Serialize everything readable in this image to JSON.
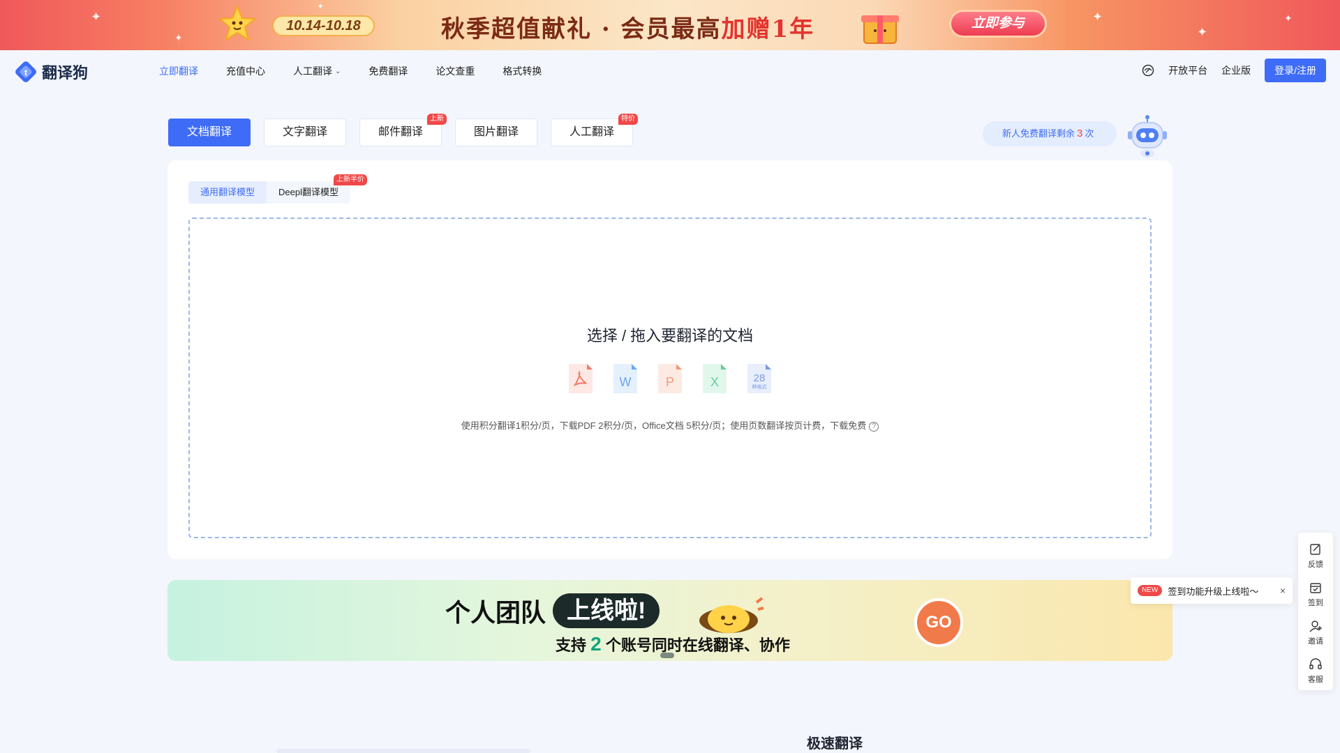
{
  "promo": {
    "date_range": "10.14-10.18",
    "headline_main": "秋季超值献礼 · 会员最高",
    "headline_highlight": "加赠1年",
    "cta_label": "立即参与"
  },
  "header": {
    "logo_text": "翻译狗",
    "nav": [
      {
        "label": "立即翻译",
        "active": true
      },
      {
        "label": "充值中心"
      },
      {
        "label": "人工翻译",
        "has_dropdown": true
      },
      {
        "label": "免费翻译"
      },
      {
        "label": "论文查重"
      },
      {
        "label": "格式转换"
      }
    ],
    "right": {
      "icon": "theme-icon",
      "open_platform": "开放平台",
      "enterprise": "企业版",
      "login_label": "登录/注册"
    }
  },
  "tabs": [
    {
      "label": "文档翻译",
      "active": true
    },
    {
      "label": "文字翻译"
    },
    {
      "label": "邮件翻译",
      "badge": "上新"
    },
    {
      "label": "图片翻译"
    },
    {
      "label": "人工翻译",
      "badge": "特价"
    }
  ],
  "free_quota": {
    "prefix": "新人免费翻译剩余",
    "count": "3",
    "suffix": "次"
  },
  "model_tabs": [
    {
      "label": "通用翻译模型",
      "active": true
    },
    {
      "label": "Deepl翻译模型",
      "badge": "上新半价"
    }
  ],
  "dropzone": {
    "title": "选择 / 拖入要翻译的文档",
    "file_types": [
      {
        "name": "pdf-file-icon",
        "glyph": "PDF",
        "color": "#f07a6a"
      },
      {
        "name": "word-file-icon",
        "glyph": "W",
        "color": "#6aa6ef"
      },
      {
        "name": "ppt-file-icon",
        "glyph": "P",
        "color": "#f09a7a"
      },
      {
        "name": "excel-file-icon",
        "glyph": "X",
        "color": "#5fcf9a"
      },
      {
        "name": "more-formats-icon",
        "glyph": "28",
        "sub": "种格式",
        "color": "#7a9ae8"
      }
    ],
    "note": "使用积分翻译1积分/页，下载PDF 2积分/页，Office文档 5积分/页；使用页数翻译按页计费，下载免费"
  },
  "team_banner": {
    "title": "个人团队",
    "pill": "上线啦!",
    "sub_prefix": "支持",
    "sub_number": "2",
    "sub_suffix": "个账号同时在线翻译、协作",
    "go_label": "GO"
  },
  "section_title": "极速翻译",
  "float_bar": [
    {
      "label": "反馈",
      "icon": "feedback-icon"
    },
    {
      "label": "签到",
      "icon": "calendar-icon"
    },
    {
      "label": "邀请",
      "icon": "invite-icon"
    },
    {
      "label": "客服",
      "icon": "headset-icon"
    }
  ],
  "toast": {
    "tag": "NEW",
    "message": "签到功能升级上线啦～",
    "close": "×"
  },
  "colors": {
    "primary": "#3e6cf6",
    "badge_red": "#f04848"
  }
}
